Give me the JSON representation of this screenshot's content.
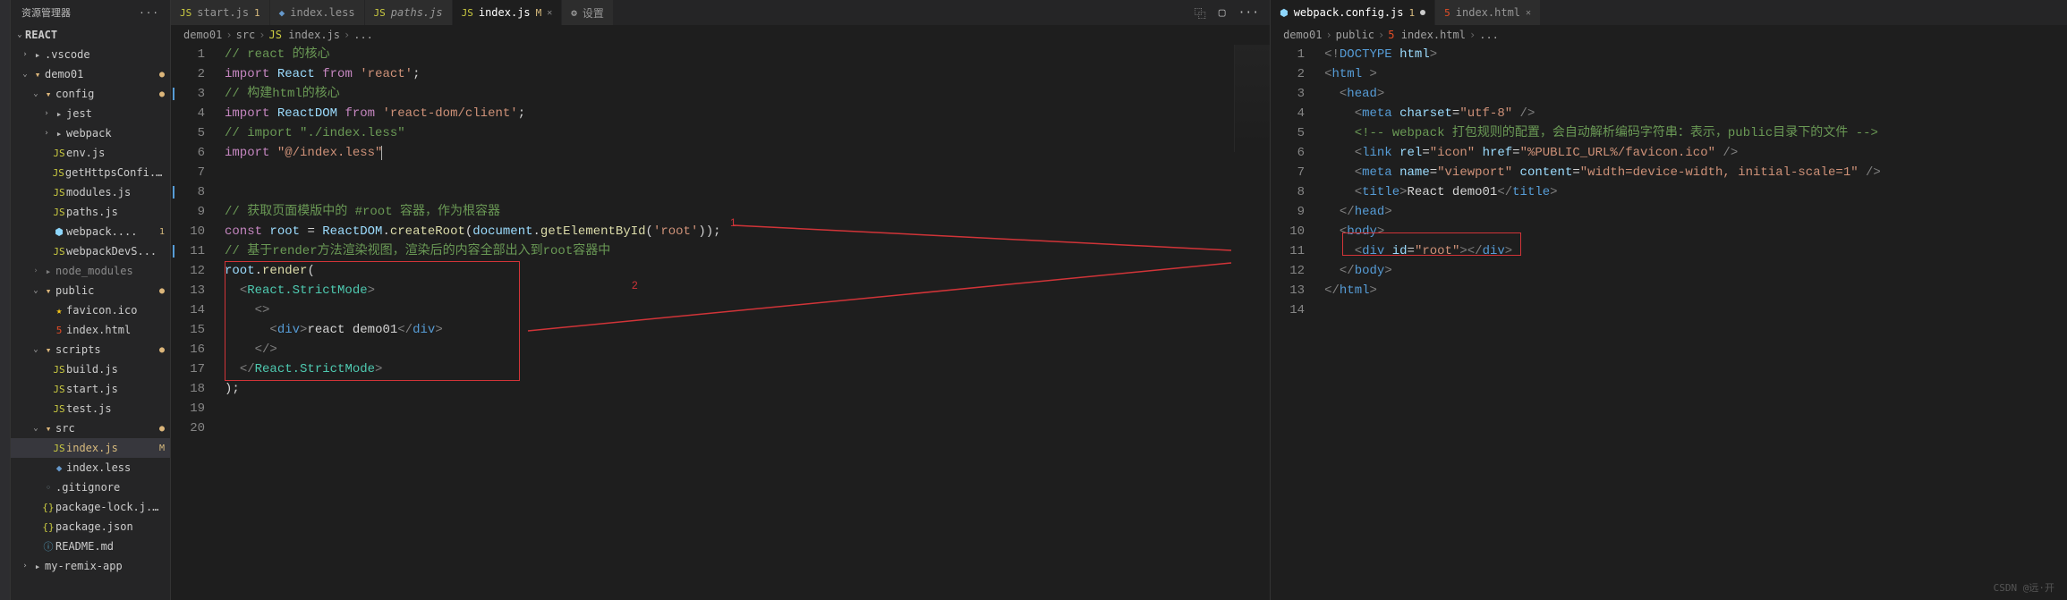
{
  "sidebar": {
    "title": "资源管理器",
    "root": "REACT",
    "tree": [
      {
        "depth": 0,
        "name": ".vscode",
        "icon": "folder",
        "chev": "›"
      },
      {
        "depth": 0,
        "name": "demo01",
        "icon": "folder-open",
        "chev": "⌄",
        "git": "●"
      },
      {
        "depth": 1,
        "name": "config",
        "icon": "folder-open",
        "chev": "⌄",
        "git": "●"
      },
      {
        "depth": 2,
        "name": "jest",
        "icon": "folder",
        "chev": "›"
      },
      {
        "depth": 2,
        "name": "webpack",
        "icon": "folder",
        "chev": "›"
      },
      {
        "depth": 2,
        "name": "env.js",
        "icon": "js"
      },
      {
        "depth": 2,
        "name": "getHttpsConfi...",
        "icon": "js"
      },
      {
        "depth": 2,
        "name": "modules.js",
        "icon": "js"
      },
      {
        "depth": 2,
        "name": "paths.js",
        "icon": "js"
      },
      {
        "depth": 2,
        "name": "webpack....",
        "icon": "webpack",
        "badge": "1"
      },
      {
        "depth": 2,
        "name": "webpackDevS...",
        "icon": "js"
      },
      {
        "depth": 1,
        "name": "node_modules",
        "icon": "folder",
        "chev": "›",
        "muted": true
      },
      {
        "depth": 1,
        "name": "public",
        "icon": "folder-open",
        "chev": "⌄",
        "git": "●"
      },
      {
        "depth": 2,
        "name": "favicon.ico",
        "icon": "ico"
      },
      {
        "depth": 2,
        "name": "index.html",
        "icon": "html"
      },
      {
        "depth": 1,
        "name": "scripts",
        "icon": "folder-open",
        "chev": "⌄",
        "git": "●"
      },
      {
        "depth": 2,
        "name": "build.js",
        "icon": "js"
      },
      {
        "depth": 2,
        "name": "start.js",
        "icon": "js"
      },
      {
        "depth": 2,
        "name": "test.js",
        "icon": "js"
      },
      {
        "depth": 1,
        "name": "src",
        "icon": "folder-open",
        "chev": "⌄",
        "git": "●"
      },
      {
        "depth": 2,
        "name": "index.js",
        "icon": "js",
        "active": true,
        "badge": "M",
        "gitM": true
      },
      {
        "depth": 2,
        "name": "index.less",
        "icon": "less"
      },
      {
        "depth": 1,
        "name": ".gitignore",
        "icon": "txt"
      },
      {
        "depth": 1,
        "name": "package-lock.j...",
        "icon": "json"
      },
      {
        "depth": 1,
        "name": "package.json",
        "icon": "json"
      },
      {
        "depth": 1,
        "name": "README.md",
        "icon": "md"
      },
      {
        "depth": 0,
        "name": "my-remix-app",
        "icon": "folder",
        "chev": "›"
      }
    ]
  },
  "groupA": {
    "tabs": [
      {
        "icon": "js",
        "name": "start.js",
        "badge": "1"
      },
      {
        "icon": "less",
        "name": "index.less"
      },
      {
        "icon": "js",
        "name": "paths.js",
        "italic": true
      },
      {
        "icon": "js",
        "name": "index.js",
        "mod": "M",
        "active": true,
        "close": true
      },
      {
        "icon": "gear",
        "name": "设置"
      }
    ],
    "actions": [
      "⿻",
      "▢",
      "···"
    ],
    "breadcrumbs": [
      {
        "text": "demo01"
      },
      {
        "text": "src"
      },
      {
        "icon": "js",
        "text": "index.js"
      },
      {
        "text": "..."
      }
    ],
    "lines": [
      {
        "n": 1,
        "html": "<span class='c-comment'>// react 的核心</span>"
      },
      {
        "n": 2,
        "html": "<span class='c-key'>import</span> <span class='c-var'>React</span> <span class='c-key'>from</span> <span class='c-str'>'react'</span><span class='c-p'>;</span>"
      },
      {
        "n": 3,
        "html": "<span class='c-comment'>// 构建html的核心</span>",
        "box": true
      },
      {
        "n": 4,
        "html": "<span class='c-key'>import</span> <span class='c-var'>ReactDOM</span> <span class='c-key'>from</span> <span class='c-str'>'react-dom/client'</span><span class='c-p'>;</span>"
      },
      {
        "n": 5,
        "html": "<span class='c-comment'>// import \"./index.less\"</span>"
      },
      {
        "n": 6,
        "html": "<span class='c-key'>import</span> <span class='c-str'>\"@/index.less\"</span><span class='cursor'></span>"
      },
      {
        "n": 7,
        "html": ""
      },
      {
        "n": 8,
        "html": "",
        "box": true
      },
      {
        "n": 9,
        "html": "<span class='c-comment'>// 获取页面模版中的 #root 容器，作为根容器</span>"
      },
      {
        "n": 10,
        "html": "<span class='c-key'>const</span> <span class='c-var'>root</span> <span class='c-p'>=</span> <span class='c-var'>ReactDOM</span><span class='c-p'>.</span><span class='c-fn'>createRoot</span><span class='c-p'>(</span><span class='c-var'>document</span><span class='c-p'>.</span><span class='c-fn'>getElementById</span><span class='c-p'>(</span><span class='c-str'>'root'</span><span class='c-p'>));</span>"
      },
      {
        "n": 11,
        "html": "<span class='c-comment'>// 基于render方法渲染视图，渲染后的内容全部出入到root容器中</span>",
        "box": true
      },
      {
        "n": 12,
        "html": "<span class='c-var'>root</span><span class='c-p'>.</span><span class='c-fn'>render</span><span class='c-p'>(</span>"
      },
      {
        "n": 13,
        "html": "  <span class='c-br'>&lt;</span><span class='c-type'>React.StrictMode</span><span class='c-br'>&gt;</span>"
      },
      {
        "n": 14,
        "html": "    <span class='c-br'>&lt;&gt;</span>"
      },
      {
        "n": 15,
        "html": "      <span class='c-br'>&lt;</span><span class='c-tag'>div</span><span class='c-br'>&gt;</span><span class='c-p'>react demo01</span><span class='c-br'>&lt;/</span><span class='c-tag'>div</span><span class='c-br'>&gt;</span>"
      },
      {
        "n": 16,
        "html": "    <span class='c-br'>&lt;/&gt;</span>"
      },
      {
        "n": 17,
        "html": "  <span class='c-br'>&lt;/</span><span class='c-type'>React.StrictMode</span><span class='c-br'>&gt;</span>"
      },
      {
        "n": 18,
        "html": "<span class='c-p'>);</span>"
      },
      {
        "n": 19,
        "html": ""
      },
      {
        "n": 20,
        "html": ""
      }
    ]
  },
  "groupB": {
    "tabs": [
      {
        "icon": "webpack",
        "name": "webpack.config.js",
        "badge": "1",
        "active": true
      },
      {
        "icon": "html",
        "name": "index.html",
        "close": true
      }
    ],
    "breadcrumbs": [
      {
        "text": "demo01"
      },
      {
        "text": "public"
      },
      {
        "icon": "html",
        "text": "index.html"
      },
      {
        "text": "..."
      }
    ],
    "lines": [
      {
        "n": 1,
        "html": "<span class='c-br'>&lt;!</span><span class='c-doctype'>DOCTYPE</span> <span class='c-attr'>html</span><span class='c-br'>&gt;</span>"
      },
      {
        "n": 2,
        "html": "<span class='c-br'>&lt;</span><span class='c-tag'>html</span> <span class='c-br'>&gt;</span>"
      },
      {
        "n": 3,
        "html": "  <span class='c-br'>&lt;</span><span class='c-tag'>head</span><span class='c-br'>&gt;</span>"
      },
      {
        "n": 4,
        "html": "    <span class='c-br'>&lt;</span><span class='c-tag'>meta</span> <span class='c-attr'>charset</span><span class='c-p'>=</span><span class='c-attrval'>\"utf-8\"</span> <span class='c-br'>/&gt;</span>"
      },
      {
        "n": 5,
        "html": "    <span class='c-comment'>&lt;!-- webpack 打包规则的配置，会自动解析编码字符串：表示，public目录下的文件 --&gt;</span>"
      },
      {
        "n": 6,
        "html": "    <span class='c-br'>&lt;</span><span class='c-tag'>link</span> <span class='c-attr'>rel</span><span class='c-p'>=</span><span class='c-attrval'>\"icon\"</span> <span class='c-attr'>href</span><span class='c-p'>=</span><span class='c-attrval'>\"%PUBLIC_URL%/favicon.ico\"</span> <span class='c-br'>/&gt;</span>"
      },
      {
        "n": 7,
        "html": "    <span class='c-br'>&lt;</span><span class='c-tag'>meta</span> <span class='c-attr'>name</span><span class='c-p'>=</span><span class='c-attrval'>\"viewport\"</span> <span class='c-attr'>content</span><span class='c-p'>=</span><span class='c-attrval'>\"width=device-width, initial-scale=1\"</span> <span class='c-br'>/&gt;</span>"
      },
      {
        "n": 8,
        "html": "    <span class='c-br'>&lt;</span><span class='c-tag'>title</span><span class='c-br'>&gt;</span><span class='c-p'>React demo01</span><span class='c-br'>&lt;/</span><span class='c-tag'>title</span><span class='c-br'>&gt;</span>"
      },
      {
        "n": 9,
        "html": "  <span class='c-br'>&lt;/</span><span class='c-tag'>head</span><span class='c-br'>&gt;</span>"
      },
      {
        "n": 10,
        "html": "  <span class='c-br'>&lt;</span><span class='c-tag'>body</span><span class='c-br'>&gt;</span>"
      },
      {
        "n": 11,
        "html": "    <span class='c-br'>&lt;</span><span class='c-tag'>div</span> <span class='c-attr'>id</span><span class='c-p'>=</span><span class='c-attrval'>\"root\"</span><span class='c-br'>&gt;&lt;/</span><span class='c-tag'>div</span><span class='c-br'>&gt;</span>"
      },
      {
        "n": 12,
        "html": "  <span class='c-br'>&lt;/</span><span class='c-tag'>body</span><span class='c-br'>&gt;</span>"
      },
      {
        "n": 13,
        "html": "<span class='c-br'>&lt;/</span><span class='c-tag'>html</span><span class='c-br'>&gt;</span>"
      },
      {
        "n": 14,
        "html": ""
      }
    ]
  },
  "annotations": {
    "label1": "1",
    "label2": "2"
  },
  "watermark": "CSDN @远·开"
}
